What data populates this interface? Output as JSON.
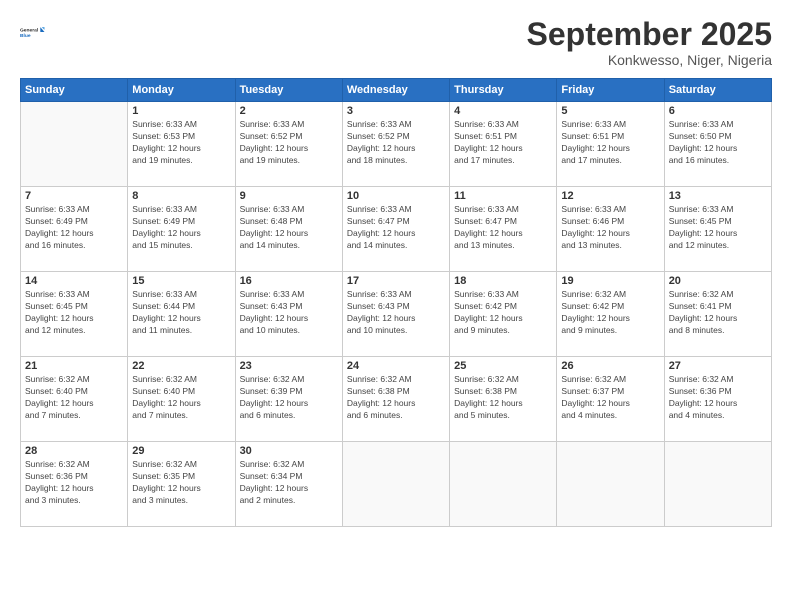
{
  "logo": {
    "line1": "General",
    "line2": "Blue"
  },
  "title": "September 2025",
  "location": "Konkwesso, Niger, Nigeria",
  "days_of_week": [
    "Sunday",
    "Monday",
    "Tuesday",
    "Wednesday",
    "Thursday",
    "Friday",
    "Saturday"
  ],
  "weeks": [
    [
      {
        "day": "",
        "info": ""
      },
      {
        "day": "1",
        "info": "Sunrise: 6:33 AM\nSunset: 6:53 PM\nDaylight: 12 hours\nand 19 minutes."
      },
      {
        "day": "2",
        "info": "Sunrise: 6:33 AM\nSunset: 6:52 PM\nDaylight: 12 hours\nand 19 minutes."
      },
      {
        "day": "3",
        "info": "Sunrise: 6:33 AM\nSunset: 6:52 PM\nDaylight: 12 hours\nand 18 minutes."
      },
      {
        "day": "4",
        "info": "Sunrise: 6:33 AM\nSunset: 6:51 PM\nDaylight: 12 hours\nand 17 minutes."
      },
      {
        "day": "5",
        "info": "Sunrise: 6:33 AM\nSunset: 6:51 PM\nDaylight: 12 hours\nand 17 minutes."
      },
      {
        "day": "6",
        "info": "Sunrise: 6:33 AM\nSunset: 6:50 PM\nDaylight: 12 hours\nand 16 minutes."
      }
    ],
    [
      {
        "day": "7",
        "info": "Sunrise: 6:33 AM\nSunset: 6:49 PM\nDaylight: 12 hours\nand 16 minutes."
      },
      {
        "day": "8",
        "info": "Sunrise: 6:33 AM\nSunset: 6:49 PM\nDaylight: 12 hours\nand 15 minutes."
      },
      {
        "day": "9",
        "info": "Sunrise: 6:33 AM\nSunset: 6:48 PM\nDaylight: 12 hours\nand 14 minutes."
      },
      {
        "day": "10",
        "info": "Sunrise: 6:33 AM\nSunset: 6:47 PM\nDaylight: 12 hours\nand 14 minutes."
      },
      {
        "day": "11",
        "info": "Sunrise: 6:33 AM\nSunset: 6:47 PM\nDaylight: 12 hours\nand 13 minutes."
      },
      {
        "day": "12",
        "info": "Sunrise: 6:33 AM\nSunset: 6:46 PM\nDaylight: 12 hours\nand 13 minutes."
      },
      {
        "day": "13",
        "info": "Sunrise: 6:33 AM\nSunset: 6:45 PM\nDaylight: 12 hours\nand 12 minutes."
      }
    ],
    [
      {
        "day": "14",
        "info": "Sunrise: 6:33 AM\nSunset: 6:45 PM\nDaylight: 12 hours\nand 12 minutes."
      },
      {
        "day": "15",
        "info": "Sunrise: 6:33 AM\nSunset: 6:44 PM\nDaylight: 12 hours\nand 11 minutes."
      },
      {
        "day": "16",
        "info": "Sunrise: 6:33 AM\nSunset: 6:43 PM\nDaylight: 12 hours\nand 10 minutes."
      },
      {
        "day": "17",
        "info": "Sunrise: 6:33 AM\nSunset: 6:43 PM\nDaylight: 12 hours\nand 10 minutes."
      },
      {
        "day": "18",
        "info": "Sunrise: 6:33 AM\nSunset: 6:42 PM\nDaylight: 12 hours\nand 9 minutes."
      },
      {
        "day": "19",
        "info": "Sunrise: 6:32 AM\nSunset: 6:42 PM\nDaylight: 12 hours\nand 9 minutes."
      },
      {
        "day": "20",
        "info": "Sunrise: 6:32 AM\nSunset: 6:41 PM\nDaylight: 12 hours\nand 8 minutes."
      }
    ],
    [
      {
        "day": "21",
        "info": "Sunrise: 6:32 AM\nSunset: 6:40 PM\nDaylight: 12 hours\nand 7 minutes."
      },
      {
        "day": "22",
        "info": "Sunrise: 6:32 AM\nSunset: 6:40 PM\nDaylight: 12 hours\nand 7 minutes."
      },
      {
        "day": "23",
        "info": "Sunrise: 6:32 AM\nSunset: 6:39 PM\nDaylight: 12 hours\nand 6 minutes."
      },
      {
        "day": "24",
        "info": "Sunrise: 6:32 AM\nSunset: 6:38 PM\nDaylight: 12 hours\nand 6 minutes."
      },
      {
        "day": "25",
        "info": "Sunrise: 6:32 AM\nSunset: 6:38 PM\nDaylight: 12 hours\nand 5 minutes."
      },
      {
        "day": "26",
        "info": "Sunrise: 6:32 AM\nSunset: 6:37 PM\nDaylight: 12 hours\nand 4 minutes."
      },
      {
        "day": "27",
        "info": "Sunrise: 6:32 AM\nSunset: 6:36 PM\nDaylight: 12 hours\nand 4 minutes."
      }
    ],
    [
      {
        "day": "28",
        "info": "Sunrise: 6:32 AM\nSunset: 6:36 PM\nDaylight: 12 hours\nand 3 minutes."
      },
      {
        "day": "29",
        "info": "Sunrise: 6:32 AM\nSunset: 6:35 PM\nDaylight: 12 hours\nand 3 minutes."
      },
      {
        "day": "30",
        "info": "Sunrise: 6:32 AM\nSunset: 6:34 PM\nDaylight: 12 hours\nand 2 minutes."
      },
      {
        "day": "",
        "info": ""
      },
      {
        "day": "",
        "info": ""
      },
      {
        "day": "",
        "info": ""
      },
      {
        "day": "",
        "info": ""
      }
    ]
  ]
}
